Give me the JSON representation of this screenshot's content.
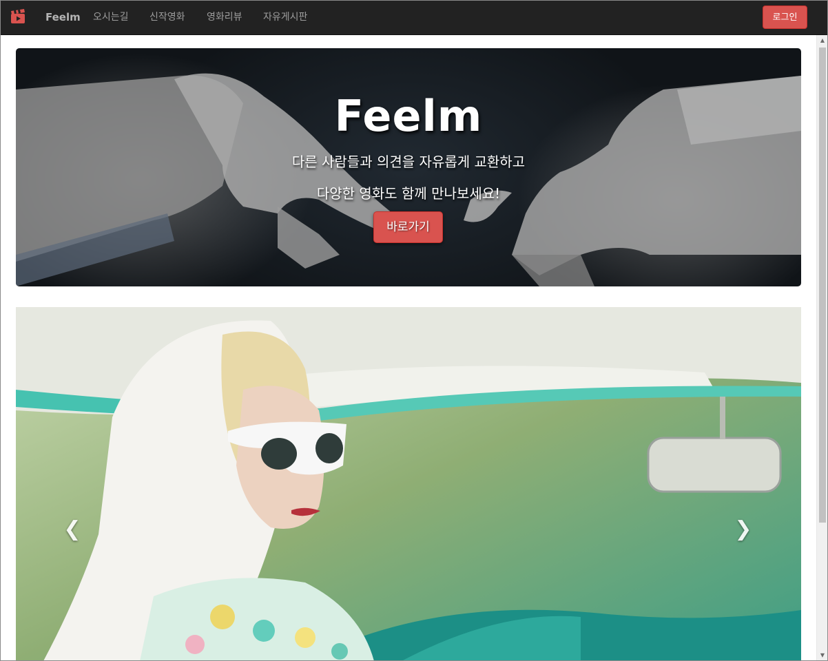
{
  "navbar": {
    "brand_icon": "clapperboard-icon",
    "brand": "Feelm",
    "items": [
      {
        "label": "오시는길"
      },
      {
        "label": "신작영화"
      },
      {
        "label": "영화리뷰"
      },
      {
        "label": "자유게시판"
      }
    ],
    "login_label": "로그인"
  },
  "hero": {
    "title": "Feelm",
    "line1": "다른 사람들과 의견을 자유롭게 교환하고",
    "line2": "다양한 영화도 함께 만나보세요!",
    "button_label": "바로가기"
  },
  "carousel": {
    "prev_icon": "chevron-left-icon",
    "next_icon": "chevron-right-icon"
  },
  "colors": {
    "navbar_bg": "#222222",
    "accent": "#d9534f",
    "nav_text": "#9d9d9d"
  }
}
